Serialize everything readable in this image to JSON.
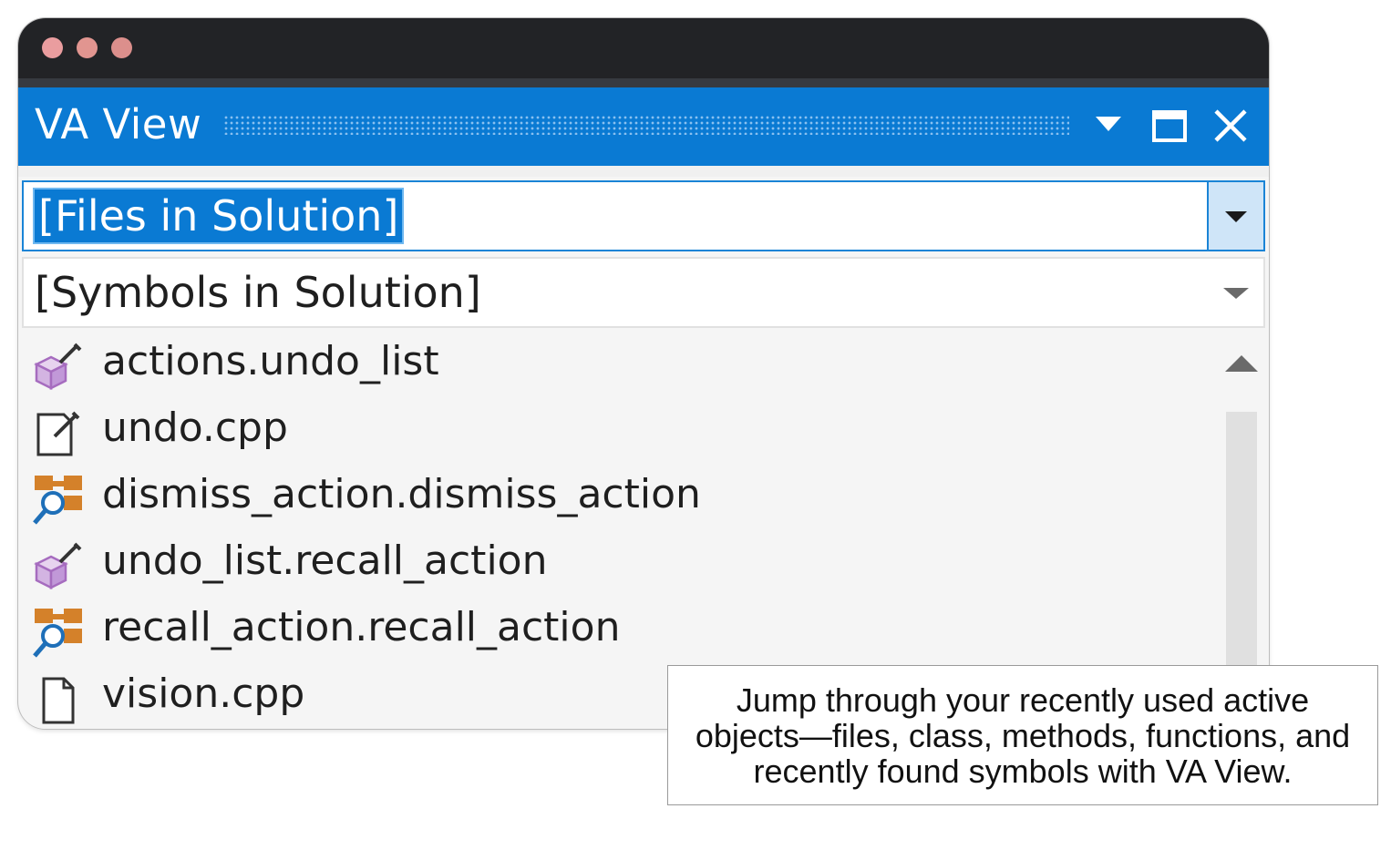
{
  "window": {
    "controls": [
      "close",
      "minimize",
      "zoom"
    ]
  },
  "panel": {
    "title": "VA View",
    "buttons": {
      "dropdown_icon": "triangle-down-icon",
      "maximize_icon": "maximize-icon",
      "close_icon": "close-icon"
    }
  },
  "files_combo": {
    "value": "[Files in Solution]",
    "selected": true
  },
  "symbols_combo": {
    "value": "[Symbols in Solution]"
  },
  "items": [
    {
      "label": "actions.undo_list",
      "icon": "edit-class-icon"
    },
    {
      "label": "undo.cpp",
      "icon": "edit-file-icon"
    },
    {
      "label": "dismiss_action.dismiss_action",
      "icon": "find-symbol-icon"
    },
    {
      "label": "undo_list.recall_action",
      "icon": "edit-class-icon"
    },
    {
      "label": "recall_action.recall_action",
      "icon": "find-symbol-icon"
    },
    {
      "label": "vision.cpp",
      "icon": "file-icon"
    }
  ],
  "callout": {
    "text": "Jump through your recently used active objects—files, class, methods, functions, and recently found symbols with VA View."
  },
  "colors": {
    "header_blue": "#0a7ad3",
    "titlebar": "#222326",
    "class_icon_purple": "#b07cc6",
    "symbol_icon_orange": "#d4812a",
    "symbol_icon_blue": "#1e6fb8"
  }
}
